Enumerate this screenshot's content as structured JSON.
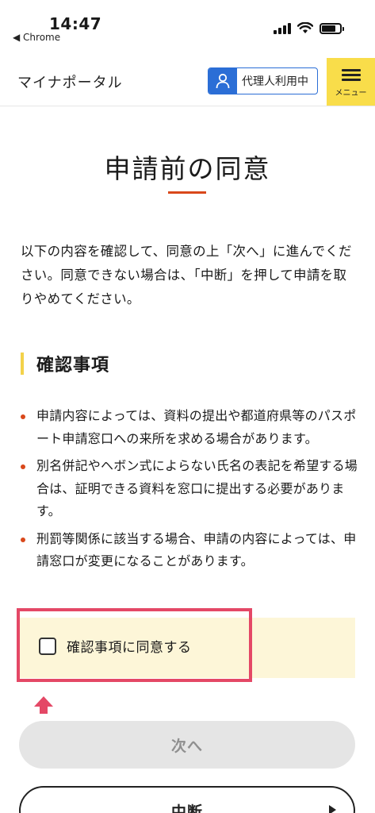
{
  "status_bar": {
    "time": "14:47",
    "back_app": "◀ Chrome"
  },
  "header": {
    "logo": "マイナポータル",
    "proxy_badge": "代理人利用中",
    "menu_label": "メニュー"
  },
  "page": {
    "title": "申請前の同意",
    "intro": "以下の内容を確認して、同意の上「次へ」に進んでください。同意できない場合は、「中断」を押して申請を取りやめてください。"
  },
  "section": {
    "title": "確認事項",
    "items": [
      "申請内容によっては、資料の提出や都道府県等のパスポート申請窓口への来所を求める場合があります。",
      "別名併記やヘボン式によらない氏名の表記を希望する場合は、証明できる資料を窓口に提出する必要があります。",
      "刑罰等関係に該当する場合、申請の内容によっては、申請窓口が変更になることがあります。"
    ]
  },
  "consent": {
    "label": "確認事項に同意する",
    "checked": false
  },
  "buttons": {
    "next": "次へ",
    "suspend": "中断"
  },
  "colors": {
    "accent_orange": "#d9481b",
    "menu_yellow": "#f9dd4a",
    "proxy_blue": "#2b6ed6",
    "highlight_red": "#e44866",
    "consent_bg": "#fdf6d8"
  }
}
